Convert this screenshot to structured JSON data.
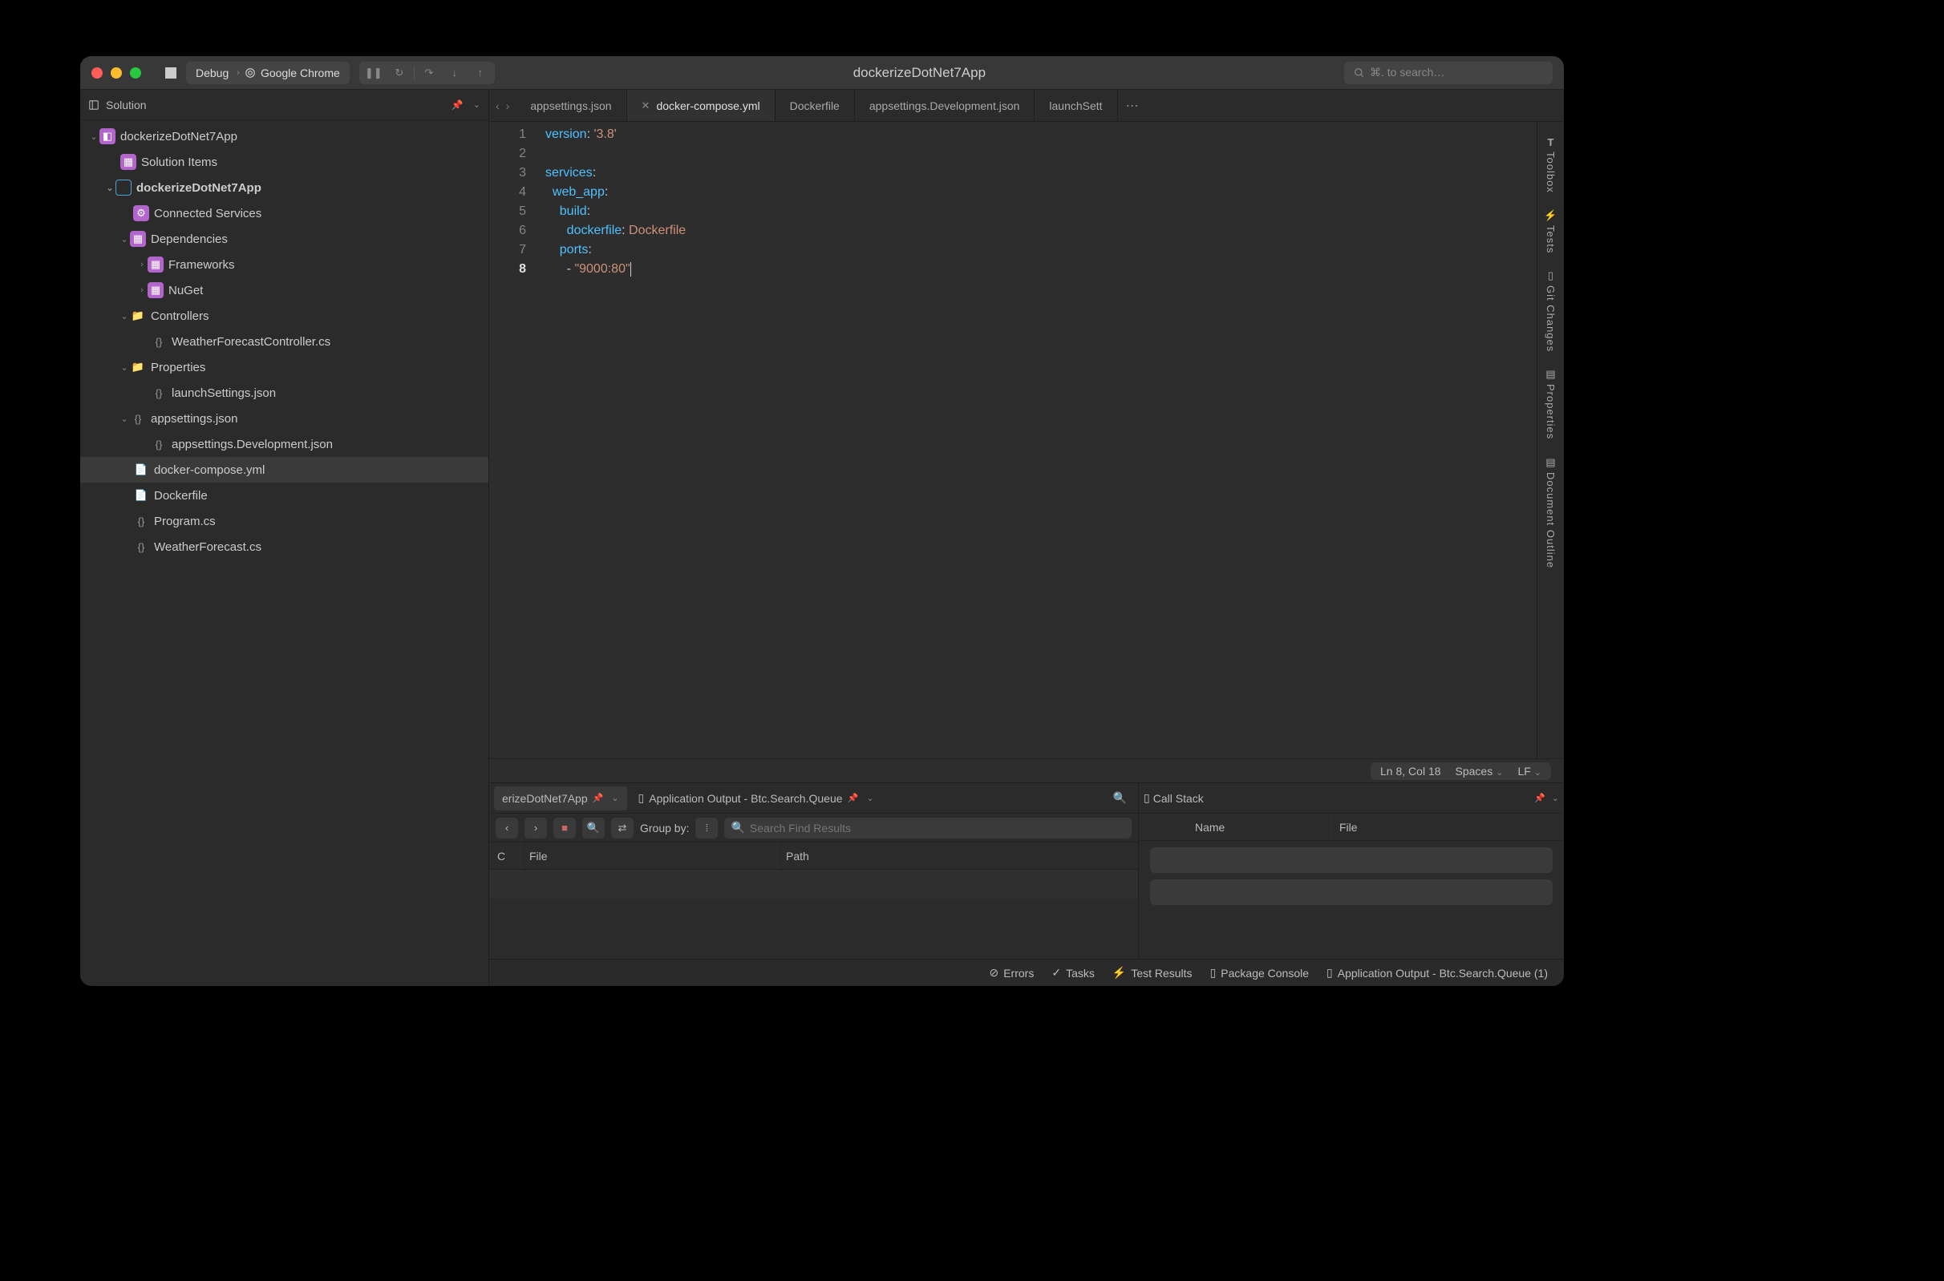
{
  "titlebar": {
    "config": "Debug",
    "target": "Google Chrome",
    "appTitle": "dockerizeDotNet7App",
    "searchPlaceholder": "⌘. to search…"
  },
  "sidebar": {
    "title": "Solution",
    "tree": {
      "root": "dockerizeDotNet7App",
      "solutionItems": "Solution Items",
      "project": "dockerizeDotNet7App",
      "connected": "Connected Services",
      "dependencies": "Dependencies",
      "frameworks": "Frameworks",
      "nuget": "NuGet",
      "controllers": "Controllers",
      "weatherCtrl": "WeatherForecastController.cs",
      "properties": "Properties",
      "launchSettings": "launchSettings.json",
      "appsettings": "appsettings.json",
      "appsettingsDev": "appsettings.Development.json",
      "dockerCompose": "docker-compose.yml",
      "dockerfile": "Dockerfile",
      "programCs": "Program.cs",
      "weatherForecast": "WeatherForecast.cs"
    }
  },
  "tabs": {
    "t0": "appsettings.json",
    "t1": "docker-compose.yml",
    "t2": "Dockerfile",
    "t3": "appsettings.Development.json",
    "t4": "launchSett"
  },
  "code": {
    "l1_k": "version",
    "l1_s": "'3.8'",
    "l3_k": "services",
    "l4_k": "web_app",
    "l5_k": "build",
    "l6_k": "dockerfile",
    "l6_v": "Dockerfile",
    "l7_k": "ports",
    "l8_s": "\"9000:80\""
  },
  "gutter": {
    "l1": "1",
    "l2": "2",
    "l3": "3",
    "l4": "4",
    "l5": "5",
    "l6": "6",
    "l7": "7",
    "l8": "8"
  },
  "editorStatus": {
    "pos": "Ln 8, Col 18",
    "indent": "Spaces",
    "eol": "LF"
  },
  "rbar": {
    "toolbox": "Toolbox",
    "tests": "Tests",
    "git": "Git Changes",
    "props": "Properties",
    "outline": "Document Outline"
  },
  "bottom": {
    "findTab": "erizeDotNet7App",
    "outputTab": "Application Output - Btc.Search.Queue",
    "callStack": "Call Stack",
    "groupBy": "Group by:",
    "searchPlaceholder": "Search Find Results",
    "colC": "C",
    "colFile": "File",
    "colPath": "Path",
    "csName": "Name",
    "csFile": "File"
  },
  "statusbar": {
    "errors": "Errors",
    "tasks": "Tasks",
    "testResults": "Test Results",
    "pkgConsole": "Package Console",
    "appOutput": "Application Output - Btc.Search.Queue (1)"
  }
}
